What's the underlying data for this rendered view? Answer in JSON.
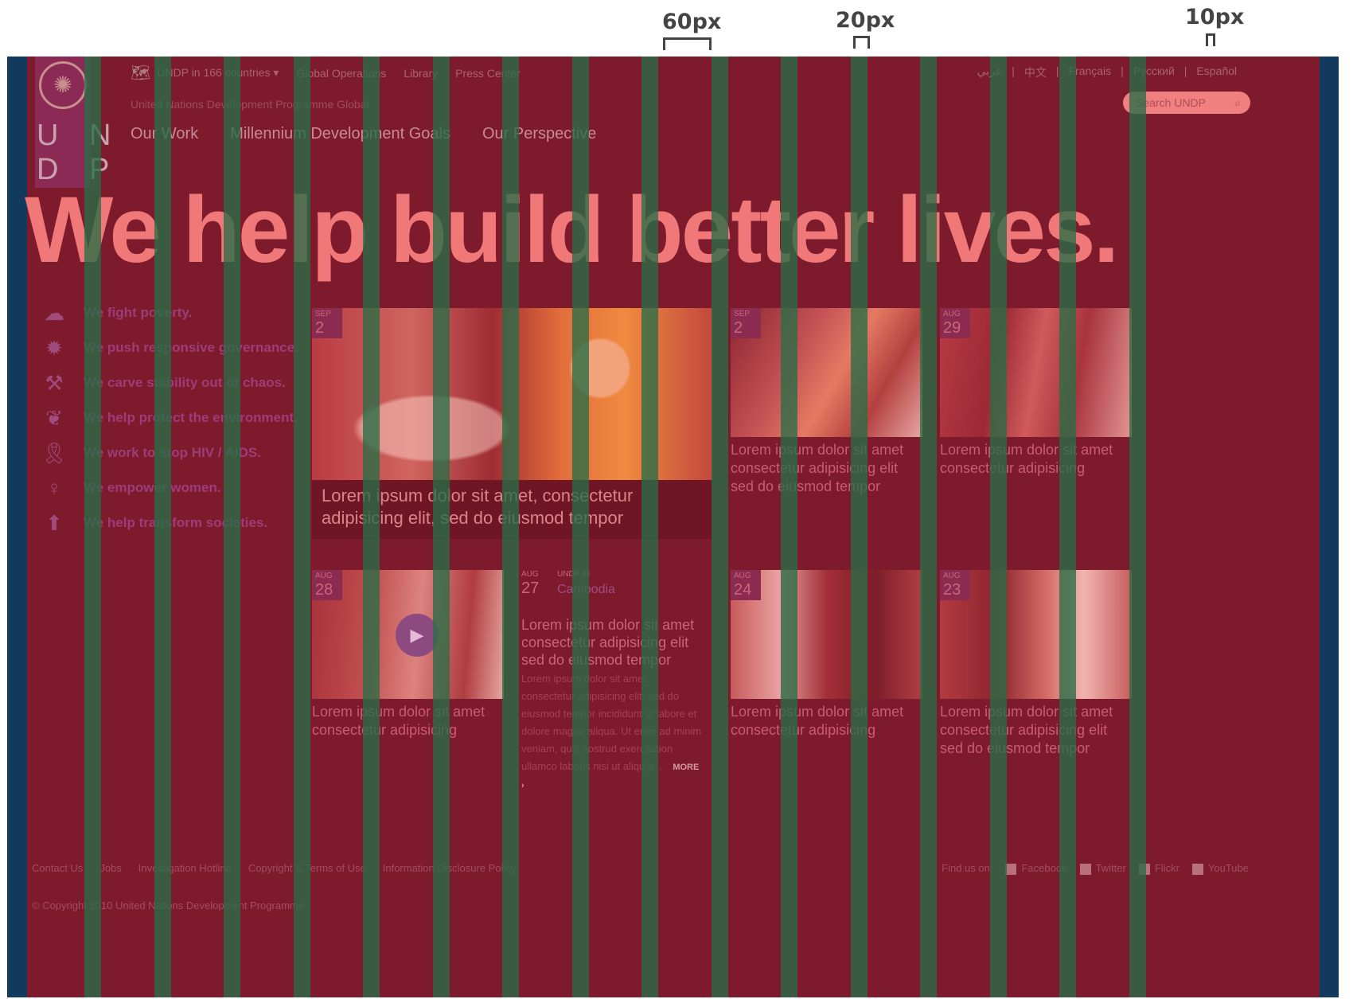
{
  "annotations": [
    "60px",
    "20px",
    "10px"
  ],
  "logo": {
    "letters": "U N\nD P"
  },
  "topbar": {
    "country_select": "UNDP in 166 countries ▾",
    "links": [
      "Global Operations",
      "Library",
      "Press Center"
    ]
  },
  "languages": [
    "عربي",
    "中文",
    "Français",
    "Русский",
    "Español"
  ],
  "site_subtitle": "United Nations Development Programme Global",
  "search": {
    "placeholder": "Search UNDP"
  },
  "mainnav": [
    "Our Work",
    "Millennium Development Goals",
    "Our Perspective"
  ],
  "hero": {
    "title": "We help build better lives."
  },
  "causes": [
    {
      "label": "We fight poverty.",
      "icon": "cloud-icon"
    },
    {
      "label": "We push responsive governance.",
      "icon": "seal-icon"
    },
    {
      "label": "We carve stability out of chaos.",
      "icon": "tools-icon"
    },
    {
      "label": "We help protect the environment.",
      "icon": "leaf-icon"
    },
    {
      "label": "We work to stop HIV / AIDS.",
      "icon": "ribbon-icon"
    },
    {
      "label": "We empower women.",
      "icon": "female-icon"
    },
    {
      "label": "We help transform societies.",
      "icon": "arrow-up-icon"
    }
  ],
  "cards": {
    "featured": {
      "month": "SEP",
      "day": "2",
      "caption": "Lorem ipsum dolor sit amet, consectetur adipisicing elit, sed do eiusmod tempor"
    },
    "c2": {
      "month": "SEP",
      "day": "2",
      "caption": "Lorem ipsum dolor sit amet consectetur adipisicing elit sed do eiusmod tempor"
    },
    "c3": {
      "month": "AUG",
      "day": "29",
      "caption": "Lorem ipsum dolor sit amet consectetur adipisicing"
    },
    "c4": {
      "month": "AUG",
      "day": "28",
      "caption": "Lorem ipsum dolor sit amet consectetur adipisicing"
    },
    "c5": {
      "month": "AUG",
      "day": "27",
      "label": "UNDP IN",
      "country": "Cambodia",
      "lead": "Lorem ipsum dolor sit amet consectetur adipisicing elit sed do eiusmod tempor",
      "body": "Lorem ipsum dolor sit amet, consectetur adipisicing elit, sed do eiusmod tempor incididunt ut labore et dolore magna aliqua. Ut enim ad minim veniam, quis nostrud exercitation ullamco laboris nisi ut aliquip...",
      "more": "MORE ›"
    },
    "c6": {
      "month": "AUG",
      "day": "24",
      "caption": "Lorem ipsum dolor sit amet consectetur adipisicing"
    },
    "c7": {
      "month": "AUG",
      "day": "23",
      "caption": "Lorem ipsum dolor sit amet consectetur adipisicing elit sed do eiusmod tempor"
    }
  },
  "footer": {
    "links": [
      "Contact Us",
      "Jobs",
      "Investigation Hotline",
      "Copyright & Terms of Use",
      "Information Disclosure Policy"
    ],
    "find_us": "Find us on:",
    "social": [
      "Facebook",
      "Twitter",
      "Flickr",
      "YouTube"
    ],
    "copyright": "© Copyright 2010 United Nations Development Programme"
  },
  "colors": {
    "overlay_red": "#7d1a2c",
    "grid_green": "#286e46",
    "edge_blue": "#123a5e",
    "hero_pink": "#f07878"
  }
}
